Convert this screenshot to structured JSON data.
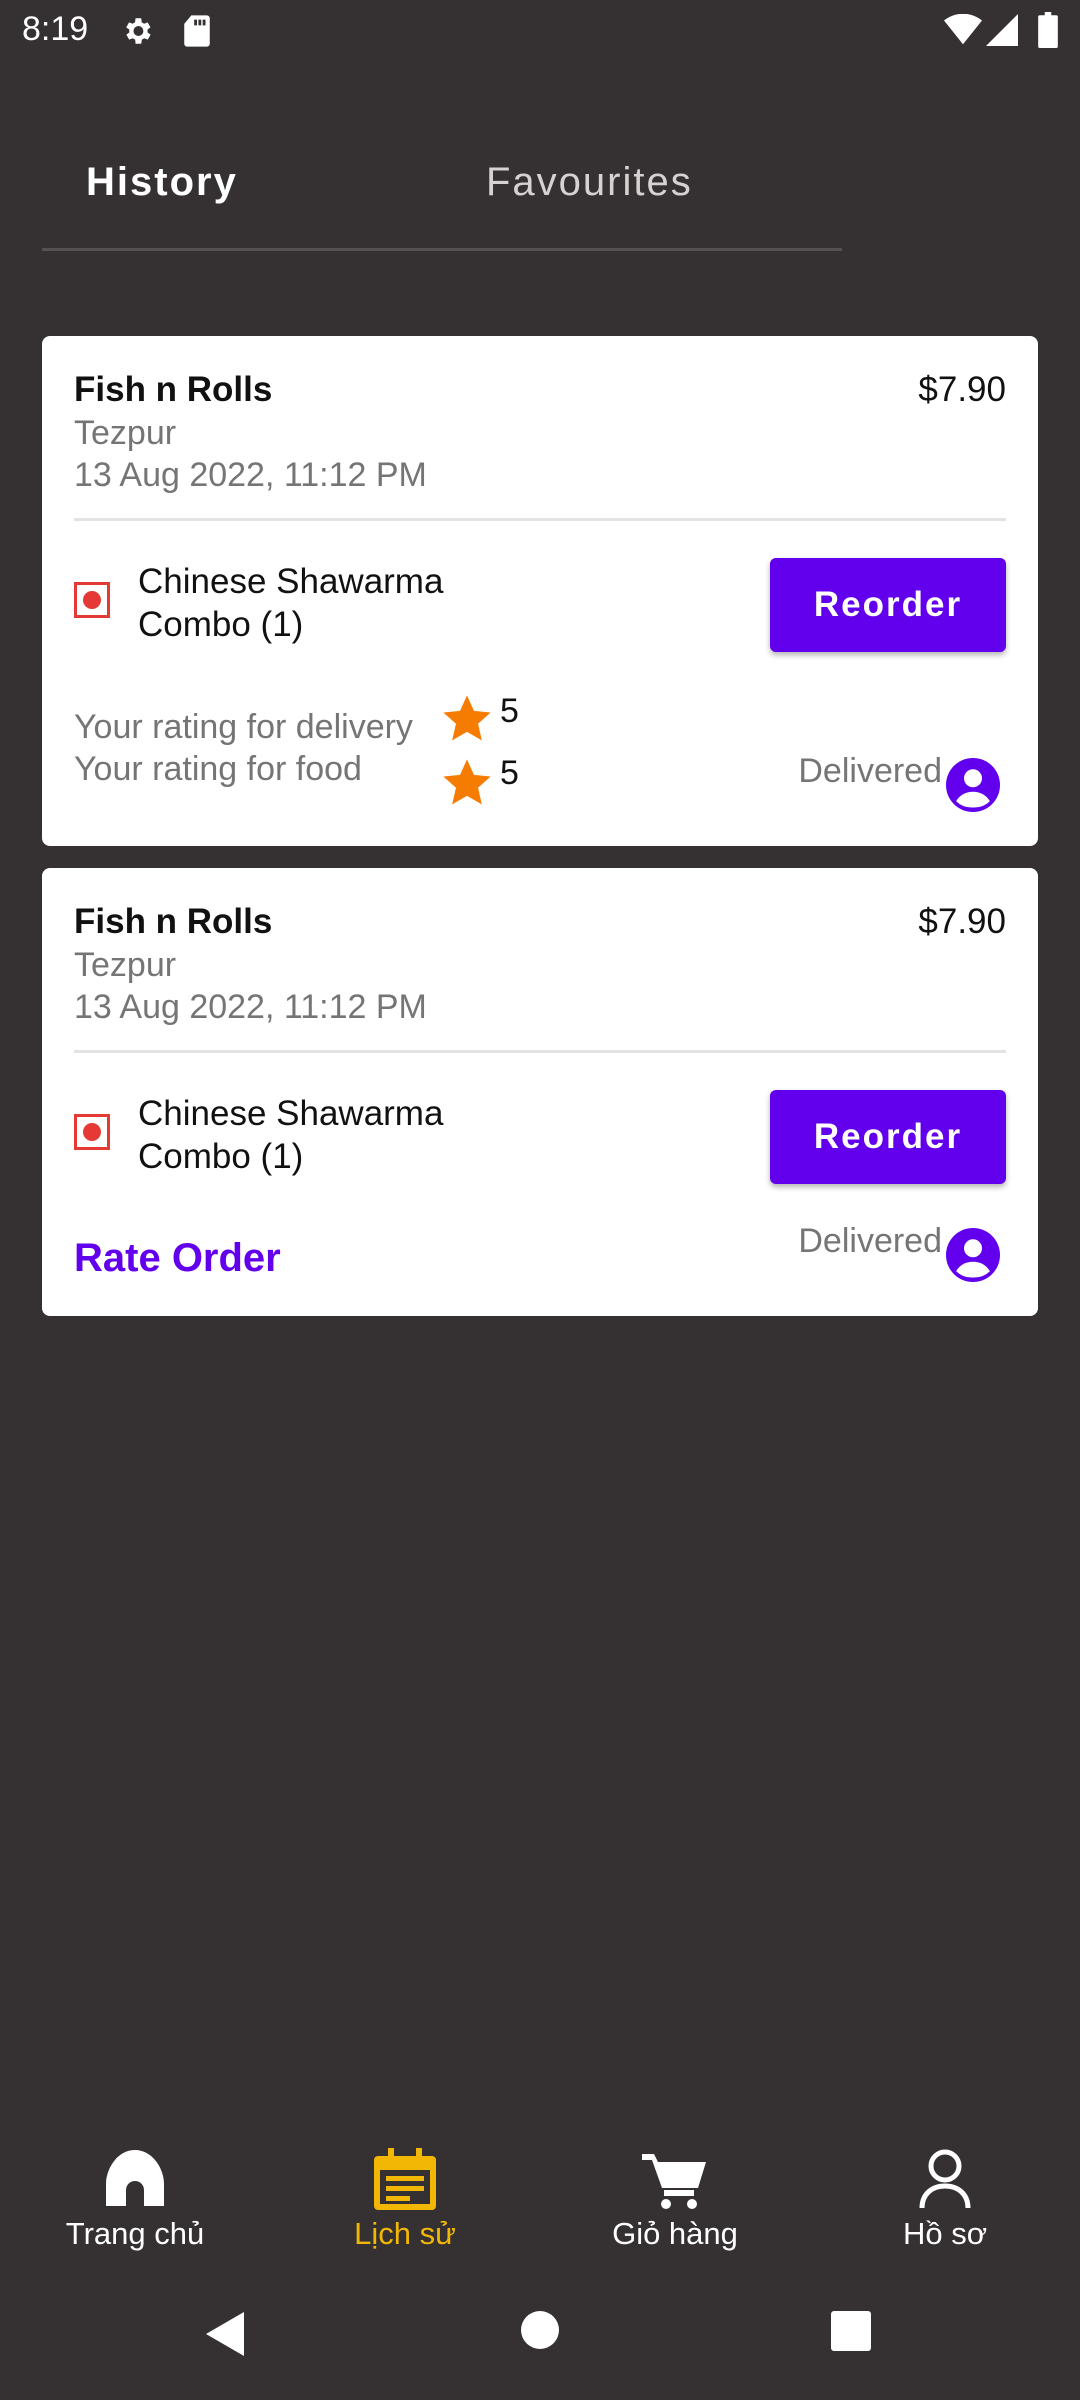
{
  "status_bar": {
    "time": "8:19",
    "left_icons": [
      "gear-icon",
      "sd-card-icon"
    ],
    "right_icons": [
      "wifi-icon",
      "signal-icon",
      "battery-icon"
    ]
  },
  "tabs": [
    {
      "label": "History",
      "active": true
    },
    {
      "label": "Favourites",
      "active": false
    }
  ],
  "orders": [
    {
      "restaurant": "Fish n Rolls",
      "price": "$7.90",
      "city": "Tezpur",
      "date": "13 Aug 2022, 11:12 PM",
      "item": "Chinese Shawarma Combo (1)",
      "reorder_label": "Reorder",
      "delivery_rating_label": "Your rating for delivery",
      "delivery_rating": "5",
      "food_rating_label": "Your rating for food",
      "food_rating": "5",
      "status": "Delivered"
    },
    {
      "restaurant": "Fish n Rolls",
      "price": "$7.90",
      "city": "Tezpur",
      "date": "13 Aug 2022, 11:12 PM",
      "item": "Chinese Shawarma Combo (1)",
      "reorder_label": "Reorder",
      "rate_order_label": "Rate Order",
      "status": "Delivered"
    }
  ],
  "bottom_nav": [
    {
      "label": "Trang chủ",
      "icon": "home-icon",
      "active": false
    },
    {
      "label": "Lịch sử",
      "icon": "history-icon",
      "active": true
    },
    {
      "label": "Giỏ hàng",
      "icon": "cart-icon",
      "active": false
    },
    {
      "label": "Hồ sơ",
      "icon": "profile-icon",
      "active": false
    }
  ],
  "system_nav": [
    "back-icon",
    "home-circle-icon",
    "recents-icon"
  ],
  "colors": {
    "background": "#353132",
    "accent": "#6200ee",
    "star": "#f57c00",
    "nav_active": "#f2b705",
    "veg_marker": "#e53935"
  }
}
